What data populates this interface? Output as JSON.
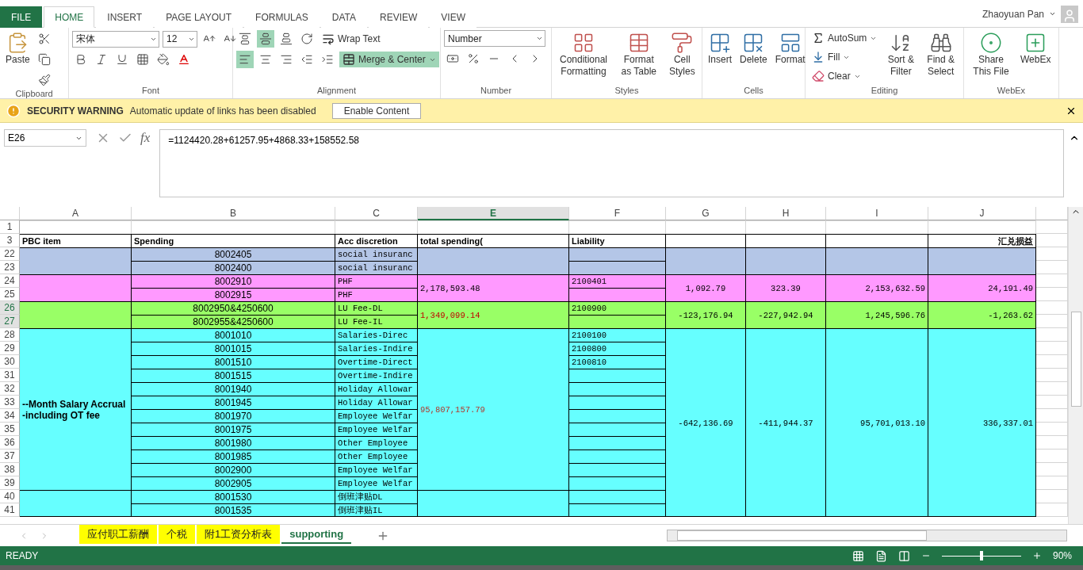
{
  "tabs": [
    {
      "label": "FILE",
      "kind": "file",
      "selected": false
    },
    {
      "label": "HOME",
      "kind": "tab",
      "selected": true
    },
    {
      "label": "INSERT",
      "kind": "tab",
      "selected": false
    },
    {
      "label": "PAGE LAYOUT",
      "kind": "tab",
      "selected": false
    },
    {
      "label": "FORMULAS",
      "kind": "tab",
      "selected": false
    },
    {
      "label": "DATA",
      "kind": "tab",
      "selected": false
    },
    {
      "label": "REVIEW",
      "kind": "tab",
      "selected": false
    },
    {
      "label": "VIEW",
      "kind": "tab",
      "selected": false
    }
  ],
  "user": {
    "name": "Zhaoyuan Pan"
  },
  "ribbon": {
    "clipboard": {
      "label": "Clipboard",
      "paste": "Paste"
    },
    "font": {
      "label": "Font",
      "name": "宋体",
      "size": "12"
    },
    "alignment": {
      "label": "Alignment",
      "wrap": "Wrap Text",
      "merge": "Merge & Center",
      "merge_on": true,
      "middle_on": true,
      "left_on": true
    },
    "number": {
      "label": "Number",
      "format": "Number"
    },
    "styles": {
      "label": "Styles",
      "buttons": [
        "Conditional Formatting",
        "Format as Table",
        "Cell Styles"
      ]
    },
    "cells": {
      "label": "Cells",
      "buttons": [
        "Insert",
        "Delete",
        "Format"
      ]
    },
    "editing": {
      "label": "Editing",
      "autosum": "AutoSum",
      "fill": "Fill",
      "clear": "Clear",
      "buttons": [
        "Sort & Filter",
        "Find & Select"
      ]
    },
    "webex": {
      "label": "WebEx",
      "buttons": [
        "Share This File",
        "WebEx"
      ]
    }
  },
  "security_bar": {
    "title": "SECURITY WARNING",
    "message": "Automatic update of links has been disabled",
    "button": "Enable Content"
  },
  "formula_bar": {
    "name_box": "E26",
    "function_label": "fx",
    "formula": "=1124420.28+61257.95+4868.33+158552.58"
  },
  "column_headers": [
    {
      "label": "A",
      "selected": false
    },
    {
      "label": "B",
      "selected": false
    },
    {
      "label": "C",
      "selected": false
    },
    {
      "label": "E",
      "selected": true
    },
    {
      "label": "F",
      "selected": false
    },
    {
      "label": "G",
      "selected": false
    },
    {
      "label": "H",
      "selected": false
    },
    {
      "label": "I",
      "selected": false
    },
    {
      "label": "J",
      "selected": false
    }
  ],
  "rows": [
    {
      "number": "1",
      "selected": false,
      "kind": "blank",
      "cells": [
        null,
        null,
        null,
        null,
        null,
        null,
        null,
        null,
        null
      ]
    },
    {
      "number": "3",
      "selected": false,
      "kind": "header",
      "cells": [
        "PBC item",
        "Spending",
        "Acc discretion",
        "total spending(",
        "Liability",
        null,
        null,
        null,
        "汇兑损益"
      ]
    },
    {
      "number": "22",
      "selected": false,
      "kind": "data",
      "color": "#b4c6e7",
      "cells": [
        null,
        "8002405",
        "social insuranc",
        null,
        null,
        null,
        null,
        null,
        null
      ]
    },
    {
      "number": "23",
      "selected": false,
      "kind": "data",
      "color": "#b4c6e7",
      "cells": [
        {
          "merged": true
        },
        "8002400",
        "social insuranc",
        {
          "merged": true
        },
        null,
        {
          "merged": true
        },
        {
          "merged": true
        },
        {
          "merged": true
        },
        {
          "merged": true
        }
      ]
    },
    {
      "number": "24",
      "selected": false,
      "kind": "data",
      "color": "#ff99ff",
      "cells": [
        null,
        "8002910",
        "PHF",
        "2,178,593.48",
        "2100401",
        "1,092.79",
        "323.39",
        "2,153,632.59",
        "24,191.49"
      ]
    },
    {
      "number": "25",
      "selected": false,
      "kind": "data",
      "color": "#ff99ff",
      "cells": [
        {
          "merged": true
        },
        "8002915",
        "PHF",
        {
          "merged": true
        },
        null,
        {
          "merged": true
        },
        {
          "merged": true
        },
        {
          "merged": true
        },
        {
          "merged": true
        }
      ]
    },
    {
      "number": "26",
      "selected": true,
      "kind": "data",
      "color": "#99ff66",
      "cells": [
        null,
        "8002950&4250600",
        "LU Fee-DL",
        {
          "text": "1,349,099.14",
          "color": "#c00000"
        },
        "2100900",
        "-123,176.94",
        "-227,942.94",
        "1,245,596.76",
        "-1,263.62"
      ]
    },
    {
      "number": "27",
      "selected": true,
      "kind": "data",
      "color": "#99ff66",
      "cells": [
        {
          "merged": true
        },
        "8002955&4250600",
        "LU Fee-IL",
        {
          "merged": true
        },
        null,
        {
          "merged": true
        },
        {
          "merged": true
        },
        {
          "merged": true
        },
        {
          "merged": true
        }
      ]
    },
    {
      "number": "28",
      "selected": false,
      "kind": "data",
      "color": "#66ffff",
      "cells": [
        "--Month Salary Accrual -including OT fee",
        "8001010",
        "Salaries-Direc",
        {
          "text": "95,807,157.79",
          "color": "#b03a2e"
        },
        "2100100",
        "-642,136.69",
        "-411,944.37",
        "95,701,013.10",
        "336,337.01"
      ]
    },
    {
      "number": "29",
      "selected": false,
      "kind": "data",
      "color": "#66ffff",
      "cells": [
        {
          "merged": true
        },
        "8001015",
        "Salaries-Indire",
        {
          "merged": true
        },
        "2100800",
        {
          "merged": true
        },
        {
          "merged": true
        },
        {
          "merged": true
        },
        {
          "merged": true
        }
      ]
    },
    {
      "number": "30",
      "selected": false,
      "kind": "data",
      "color": "#66ffff",
      "cells": [
        {
          "merged": true
        },
        "8001510",
        "Overtime-Direct",
        {
          "merged": true
        },
        "2100810",
        {
          "merged": true
        },
        {
          "merged": true
        },
        {
          "merged": true
        },
        {
          "merged": true
        }
      ]
    },
    {
      "number": "31",
      "selected": false,
      "kind": "data",
      "color": "#66ffff",
      "cells": [
        {
          "merged": true
        },
        "8001515",
        "Overtime-Indire",
        {
          "merged": true
        },
        null,
        {
          "merged": true
        },
        {
          "merged": true
        },
        {
          "merged": true
        },
        {
          "merged": true
        }
      ]
    },
    {
      "number": "32",
      "selected": false,
      "kind": "data",
      "color": "#66ffff",
      "cells": [
        {
          "merged": true
        },
        "8001940",
        "Holiday Allowar",
        {
          "merged": true
        },
        null,
        {
          "merged": true
        },
        {
          "merged": true
        },
        {
          "merged": true
        },
        {
          "merged": true
        }
      ]
    },
    {
      "number": "33",
      "selected": false,
      "kind": "data",
      "color": "#66ffff",
      "cells": [
        {
          "merged": true
        },
        "8001945",
        "Holiday Allowar",
        {
          "merged": true
        },
        null,
        {
          "merged": true
        },
        {
          "merged": true
        },
        {
          "merged": true
        },
        {
          "merged": true
        }
      ]
    },
    {
      "number": "34",
      "selected": false,
      "kind": "data",
      "color": "#66ffff",
      "cells": [
        {
          "merged": true
        },
        "8001970",
        "Employee Welfar",
        {
          "merged": true
        },
        null,
        {
          "merged": true
        },
        {
          "merged": true
        },
        {
          "merged": true
        },
        {
          "merged": true
        }
      ]
    },
    {
      "number": "35",
      "selected": false,
      "kind": "data",
      "color": "#66ffff",
      "cells": [
        {
          "merged": true
        },
        "8001975",
        "Employee Welfar",
        {
          "merged": true
        },
        null,
        {
          "merged": true
        },
        {
          "merged": true
        },
        {
          "merged": true
        },
        {
          "merged": true
        }
      ]
    },
    {
      "number": "36",
      "selected": false,
      "kind": "data",
      "color": "#66ffff",
      "cells": [
        {
          "merged": true
        },
        "8001980",
        "Other Employee",
        {
          "merged": true
        },
        null,
        {
          "merged": true
        },
        {
          "merged": true
        },
        {
          "merged": true
        },
        {
          "merged": true
        }
      ]
    },
    {
      "number": "37",
      "selected": false,
      "kind": "data",
      "color": "#66ffff",
      "cells": [
        {
          "merged": true
        },
        "8001985",
        "Other Employee",
        {
          "merged": true
        },
        null,
        {
          "merged": true
        },
        {
          "merged": true
        },
        {
          "merged": true
        },
        {
          "merged": true
        }
      ]
    },
    {
      "number": "38",
      "selected": false,
      "kind": "data",
      "color": "#66ffff",
      "cells": [
        {
          "merged": true
        },
        "8002900",
        "Employee Welfar",
        {
          "merged": true
        },
        null,
        {
          "merged": true
        },
        {
          "merged": true
        },
        {
          "merged": true
        },
        {
          "merged": true
        }
      ]
    },
    {
      "number": "39",
      "selected": false,
      "kind": "data",
      "color": "#66ffff",
      "cells": [
        {
          "merged": true
        },
        "8002905",
        "Employee Welfar",
        {
          "merged": true
        },
        null,
        {
          "merged": true
        },
        {
          "merged": true
        },
        {
          "merged": true
        },
        {
          "merged": true
        }
      ]
    },
    {
      "number": "40",
      "selected": false,
      "kind": "data",
      "color": "#66ffff",
      "cells": [
        null,
        "8001530",
        "倒班津贴DL",
        null,
        null,
        {
          "merged": true
        },
        {
          "merged": true
        },
        {
          "merged": true
        },
        {
          "merged": true
        }
      ]
    },
    {
      "number": "41",
      "selected": false,
      "kind": "data",
      "color": "#66ffff",
      "cells": [
        {
          "merged": true
        },
        "8001535",
        "倒班津贴IL",
        {
          "merged": true
        },
        null,
        {
          "merged": true
        },
        {
          "merged": true
        },
        {
          "merged": true
        },
        {
          "merged": true
        }
      ]
    }
  ],
  "sheet_tabs": [
    {
      "label": "应付职工薪酬",
      "selected": false,
      "color": "#ffff00"
    },
    {
      "label": "个税",
      "selected": false,
      "color": "#ffff00"
    },
    {
      "label": "附1工资分析表",
      "selected": false,
      "color": "#ffff00"
    },
    {
      "label": "supporting",
      "selected": true,
      "color": "#ffffff"
    }
  ],
  "status_bar": {
    "status": "READY",
    "zoom": "90%",
    "zoom_slider": {
      "level": 0.5
    }
  }
}
